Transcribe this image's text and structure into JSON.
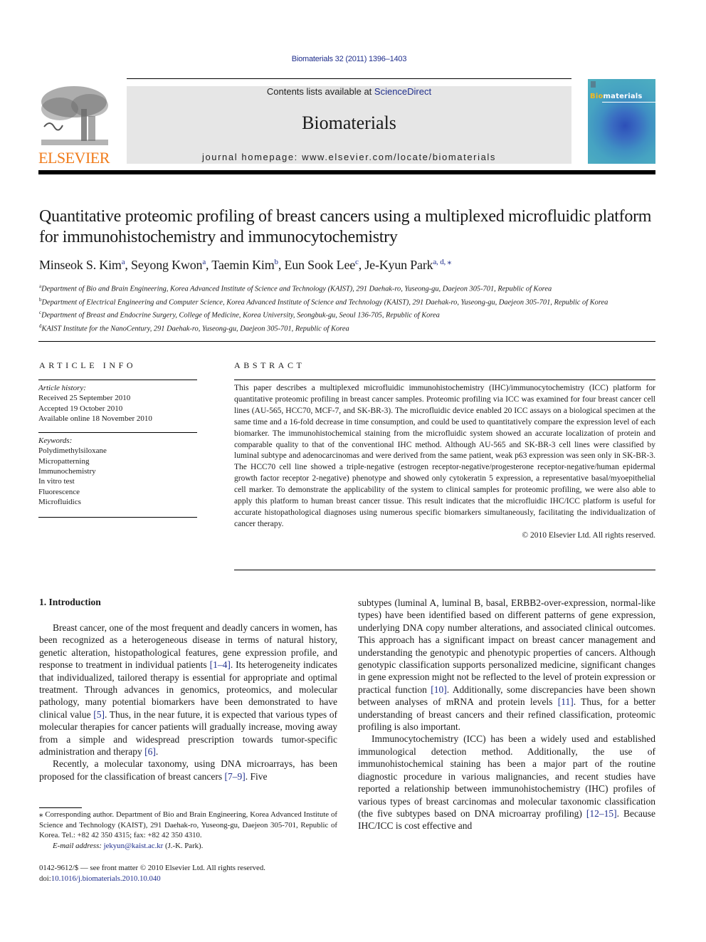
{
  "header": {
    "citation": "Biomaterials 32 (2011) 1396–1403",
    "contents_prefix": "Contents lists available at ",
    "contents_link": "ScienceDirect",
    "journal_name": "Biomaterials",
    "homepage": "journal homepage: www.elsevier.com/locate/biomaterials",
    "publisher_logo_text": "ELSEVIER",
    "cover": {
      "title_highlight": "Bio",
      "title_rest": "materials"
    },
    "colors": {
      "link": "#1f2e8c",
      "elsevier_orange": "#f07b1a",
      "masthead_bg": "#e6e6e6"
    }
  },
  "article": {
    "title": "Quantitative proteomic profiling of breast cancers using a multiplexed microfluidic platform for immunohistochemistry and immunocytochemistry",
    "authors": [
      {
        "name": "Minseok S. Kim",
        "aff": "a",
        "sep": ", "
      },
      {
        "name": "Seyong Kwon",
        "aff": "a",
        "sep": ", "
      },
      {
        "name": "Taemin Kim",
        "aff": "b",
        "sep": ", "
      },
      {
        "name": "Eun Sook Lee",
        "aff": "c",
        "sep": ", "
      },
      {
        "name": "Je-Kyun Park",
        "aff": "a, d, ⁎",
        "sep": ""
      }
    ],
    "affiliations": [
      {
        "key": "a",
        "text": "Department of Bio and Brain Engineering, Korea Advanced Institute of Science and Technology (KAIST), 291 Daehak-ro, Yuseong-gu, Daejeon 305-701, Republic of Korea"
      },
      {
        "key": "b",
        "text": "Department of Electrical Engineering and Computer Science, Korea Advanced Institute of Science and Technology (KAIST), 291 Daehak-ro, Yuseong-gu, Daejeon 305-701, Republic of Korea"
      },
      {
        "key": "c",
        "text": "Department of Breast and Endocrine Surgery, College of Medicine, Korea University, Seongbuk-gu, Seoul 136-705, Republic of Korea"
      },
      {
        "key": "d",
        "text": "KAIST Institute for the NanoCentury, 291 Daehak-ro, Yuseong-gu, Daejeon 305-701, Republic of Korea"
      }
    ]
  },
  "article_info": {
    "heading": "ARTICLE INFO",
    "history_label": "Article history:",
    "history": [
      "Received 25 September 2010",
      "Accepted 19 October 2010",
      "Available online 18 November 2010"
    ],
    "keywords_label": "Keywords:",
    "keywords": [
      "Polydimethylsiloxane",
      "Micropatterning",
      "Immunochemistry",
      "In vitro test",
      "Fluorescence",
      "Microfluidics"
    ]
  },
  "abstract": {
    "heading": "ABSTRACT",
    "text": "This paper describes a multiplexed microfluidic immunohistochemistry (IHC)/immunocytochemistry (ICC) platform for quantitative proteomic profiling in breast cancer samples. Proteomic profiling via ICC was examined for four breast cancer cell lines (AU-565, HCC70, MCF-7, and SK-BR-3). The microfluidic device enabled 20 ICC assays on a biological specimen at the same time and a 16-fold decrease in time consumption, and could be used to quantitatively compare the expression level of each biomarker. The immunohistochemical staining from the microfluidic system showed an accurate localization of protein and comparable quality to that of the conventional IHC method. Although AU-565 and SK-BR-3 cell lines were classified by luminal subtype and adenocarcinomas and were derived from the same patient, weak p63 expression was seen only in SK-BR-3. The HCC70 cell line showed a triple-negative (estrogen receptor-negative/progesterone receptor-negative/human epidermal growth factor receptor 2-negative) phenotype and showed only cytokeratin 5 expression, a representative basal/myoepithelial cell marker. To demonstrate the applicability of the system to clinical samples for proteomic profiling, we were also able to apply this platform to human breast cancer tissue. This result indicates that the microfluidic IHC/ICC platform is useful for accurate histopathological diagnoses using numerous specific biomarkers simultaneously, facilitating the individualization of cancer therapy.",
    "copyright": "© 2010 Elsevier Ltd. All rights reserved."
  },
  "body": {
    "section_heading": "1.  Introduction",
    "left_paragraphs": [
      [
        {
          "t": "Breast cancer, one of the most frequent and deadly cancers in women, has been recognized as a heterogeneous disease in terms of natural history, genetic alteration, histopathological features, gene expression profile, and response to treatment in individual patients "
        },
        {
          "t": "[1–4]",
          "ref": true
        },
        {
          "t": ". Its heterogeneity indicates that individualized, tailored therapy is essential for appropriate and optimal treatment. Through advances in genomics, proteomics, and molecular pathology, many potential biomarkers have been demonstrated to have clinical value "
        },
        {
          "t": "[5]",
          "ref": true
        },
        {
          "t": ". Thus, in the near future, it is expected that various types of molecular therapies for cancer patients will gradually increase, moving away from a simple and widespread prescription towards tumor-specific administration and therapy "
        },
        {
          "t": "[6]",
          "ref": true
        },
        {
          "t": "."
        }
      ],
      [
        {
          "t": "Recently, a molecular taxonomy, using DNA microarrays, has been proposed for the classification of breast cancers "
        },
        {
          "t": "[7–9]",
          "ref": true
        },
        {
          "t": ". Five"
        }
      ]
    ],
    "right_paragraphs": [
      [
        {
          "t": "subtypes (luminal A, luminal B, basal, ERBB2-over-expression, normal-like types) have been identified based on different patterns of gene expression, underlying DNA copy number alterations, and associated clinical outcomes. This approach has a significant impact on breast cancer management and understanding the genotypic and phenotypic properties of cancers. Although genotypic classification supports personalized medicine, significant changes in gene expression might not be reflected to the level of protein expression or practical function "
        },
        {
          "t": "[10]",
          "ref": true
        },
        {
          "t": ". Additionally, some discrepancies have been shown between analyses of mRNA and protein levels "
        },
        {
          "t": "[11]",
          "ref": true
        },
        {
          "t": ". Thus, for a better understanding of breast cancers and their refined classification, proteomic profiling is also important."
        }
      ],
      [
        {
          "t": "Immunocytochemistry (ICC) has been a widely used and established immunological detection method. Additionally, the use of immunohistochemical staining has been a major part of the routine diagnostic procedure in various malignancies, and recent studies have reported a relationship between immunohistochemistry (IHC) profiles of various types of breast carcinomas and molecular taxonomic classification (the five subtypes based on DNA microarray profiling) "
        },
        {
          "t": "[12–15]",
          "ref": true
        },
        {
          "t": ". Because IHC/ICC is cost effective and"
        }
      ]
    ]
  },
  "footnote": {
    "corresponding": "⁎ Corresponding author. Department of Bio and Brain Engineering, Korea Advanced Institute of Science and Technology (KAIST), 291 Daehak-ro, Yuseong-gu, Daejeon 305-701, Republic of Korea. Tel.: +82 42 350 4315; fax: +82 42 350 4310.",
    "email_label": "E-mail address:",
    "email": "jekyun@kaist.ac.kr",
    "email_suffix": " (J.-K. Park).",
    "front_matter": "0142-9612/$ — see front matter © 2010 Elsevier Ltd. All rights reserved.",
    "doi_label": "doi:",
    "doi": "10.1016/j.biomaterials.2010.10.040"
  }
}
